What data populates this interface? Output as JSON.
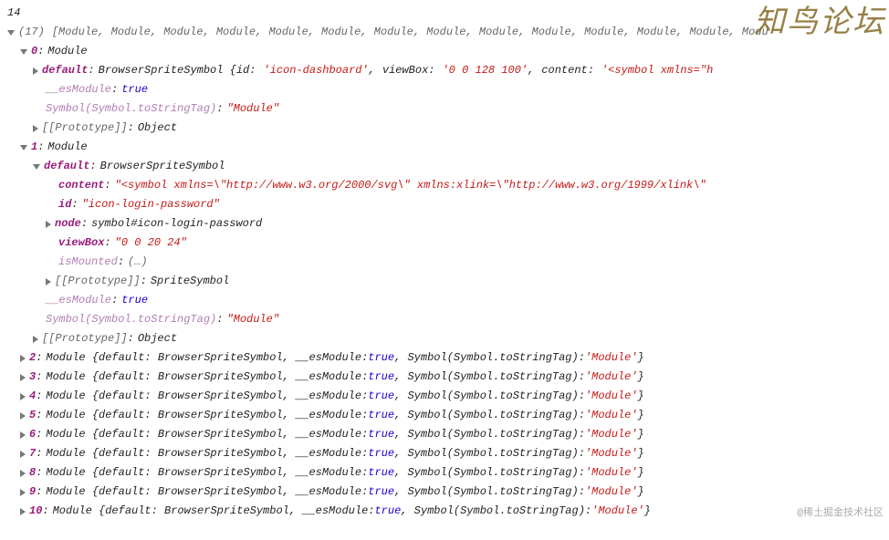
{
  "line_num": "14",
  "array_header": {
    "len": "(17)",
    "preview": "[Module, Module, Module, Module, Module, Module, Module, Module, Module, Module, Module, Module, Module, Modu"
  },
  "item0": {
    "idx": "0",
    "type": "Module",
    "default_prefix": "BrowserSpriteSymbol {id:",
    "id_val": "'icon-dashboard'",
    "viewBox_label": "viewBox:",
    "viewBox_val": "'0 0 128 100'",
    "content_label": "content:",
    "content_val": "'<symbol xmlns=\"h",
    "esModule": "true",
    "symbolTag": "Symbol(Symbol.toStringTag)",
    "symbolVal": "\"Module\"",
    "proto": "[[Prototype]]",
    "protoVal": "Object"
  },
  "item1": {
    "idx": "1",
    "type": "Module",
    "default_label": "default",
    "default_val": "BrowserSpriteSymbol",
    "content_label": "content",
    "content_val": "\"<symbol xmlns=\\\"http://www.w3.org/2000/svg\\\" xmlns:xlink=\\\"http://www.w3.org/1999/xlink\\\"",
    "id_label": "id",
    "id_val": "\"icon-login-password\"",
    "node_label": "node",
    "node_val": "symbol#icon-login-password",
    "viewBox_label": "viewBox",
    "viewBox_val": "\"0 0 20 24\"",
    "isMounted_label": "isMounted",
    "isMounted_val": "(…)",
    "proto_label": "[[Prototype]]",
    "proto_val": "SpriteSymbol",
    "esModule_label": "__esModule",
    "esModule_val": "true",
    "symbolTag": "Symbol(Symbol.toStringTag)",
    "symbolVal": "\"Module\"",
    "proto2_label": "[[Prototype]]",
    "proto2_val": "Object"
  },
  "collapsed": {
    "pre": "Module {default: BrowserSpriteSymbol, __esModule:",
    "boolv": "true",
    "mid": ", Symbol(Symbol.toStringTag):",
    "strv": "'Module'",
    "suf": "}"
  },
  "labels": {
    "default": "default",
    "esModule": "__esModule"
  },
  "watermark1": "知鸟论坛",
  "watermark2": "@稀土掘金技术社区"
}
